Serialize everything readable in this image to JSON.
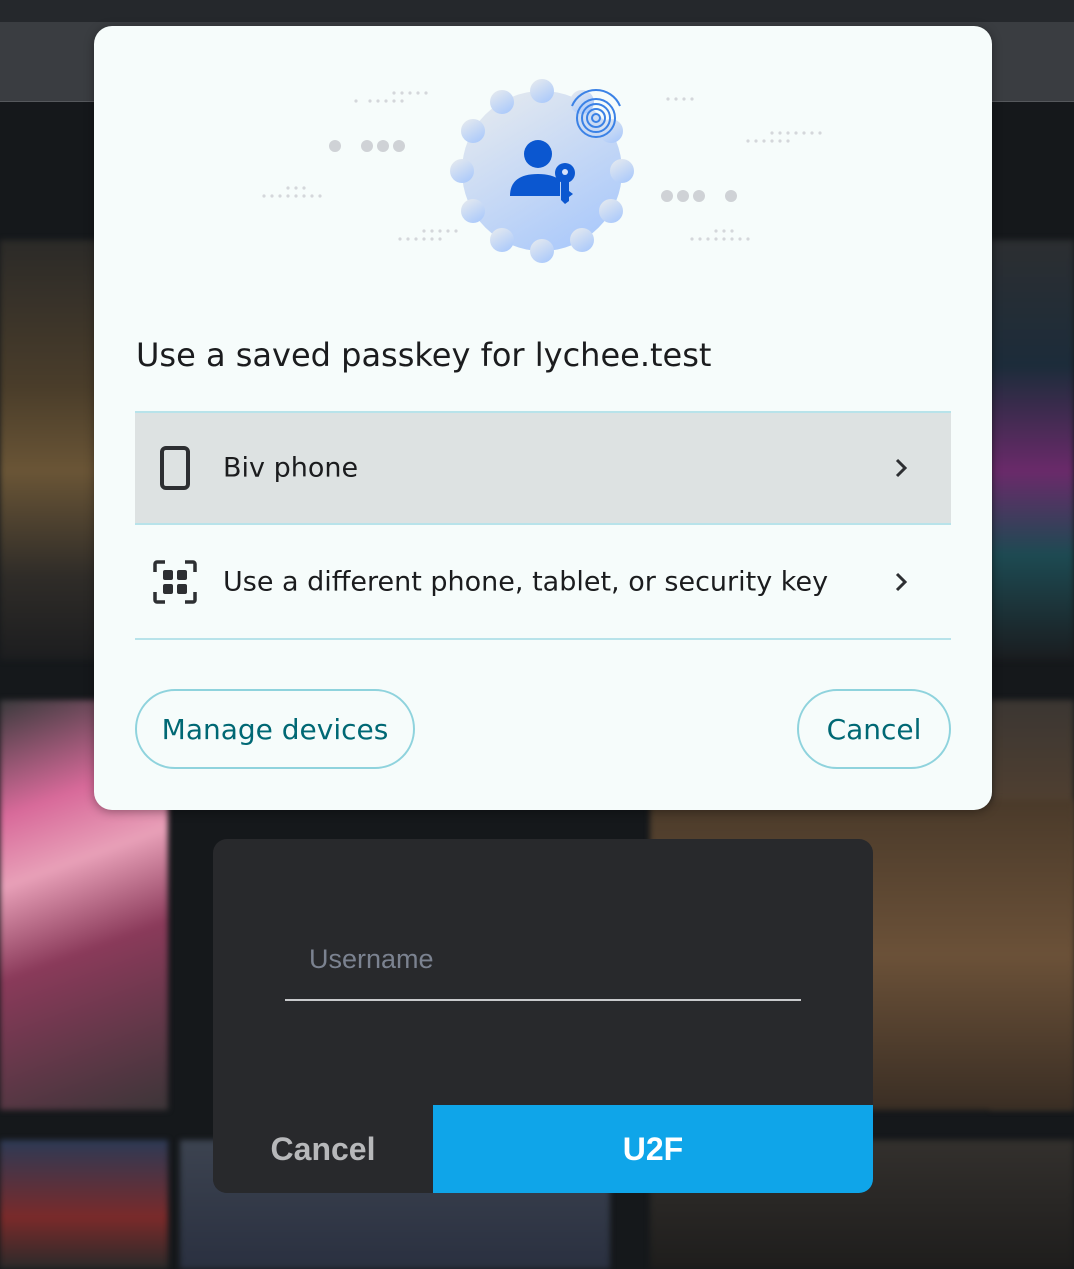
{
  "passkey_dialog": {
    "title": "Use a saved passkey for lychee.test",
    "options": [
      {
        "label": "Biv phone",
        "icon": "smartphone-icon",
        "selected": true
      },
      {
        "label": "Use a different phone, tablet, or security key",
        "icon": "qr-code-icon",
        "selected": false
      }
    ],
    "manage_devices_label": "Manage devices",
    "cancel_label": "Cancel",
    "illustration_icon": "passkey-person-key-icon",
    "colors": {
      "accent": "#006874",
      "divider": "#b8e3ea",
      "icon_blue": "#0b57d0"
    }
  },
  "login_dialog": {
    "username_placeholder": "Username",
    "username_value": "",
    "cancel_label": "Cancel",
    "u2f_label": "U2F",
    "colors": {
      "primary": "#0fa5e9",
      "background": "#28292c"
    }
  }
}
